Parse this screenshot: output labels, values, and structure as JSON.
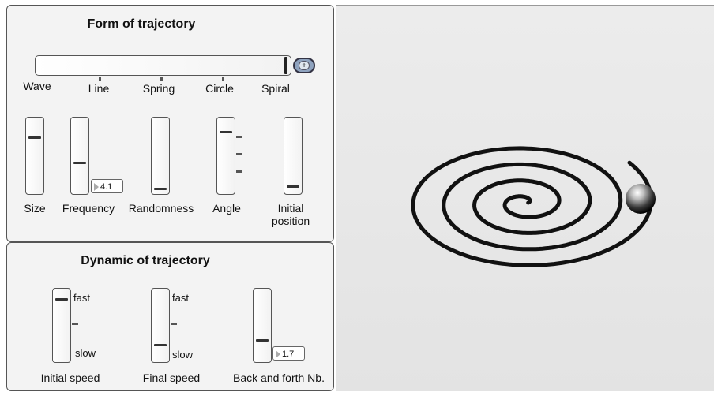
{
  "form_panel": {
    "title": "Form of trajectory",
    "shape_slider": {
      "labels": [
        "Wave",
        "Line",
        "Spring",
        "Circle",
        "Spiral"
      ],
      "selected": "Spiral",
      "expand_button": "+"
    },
    "sliders": [
      {
        "label": "Size",
        "level": 0.75
      },
      {
        "label": "Frequency",
        "level": 0.4,
        "value": "4.1"
      },
      {
        "label": "Randomness",
        "level": 0.03
      },
      {
        "label": "Angle",
        "level": 0.82
      },
      {
        "label_line1": "Initial",
        "label_line2": "position",
        "level": 0.08
      }
    ]
  },
  "dynamic_panel": {
    "title": "Dynamic of trajectory",
    "sliders": [
      {
        "label": "Initial speed",
        "top": "fast",
        "bottom": "slow",
        "level": 0.85
      },
      {
        "label": "Final speed",
        "top": "fast",
        "bottom": "slow",
        "level": 0.2
      },
      {
        "label": "Back and forth Nb.",
        "level": 0.3,
        "value": "1.7"
      }
    ]
  }
}
